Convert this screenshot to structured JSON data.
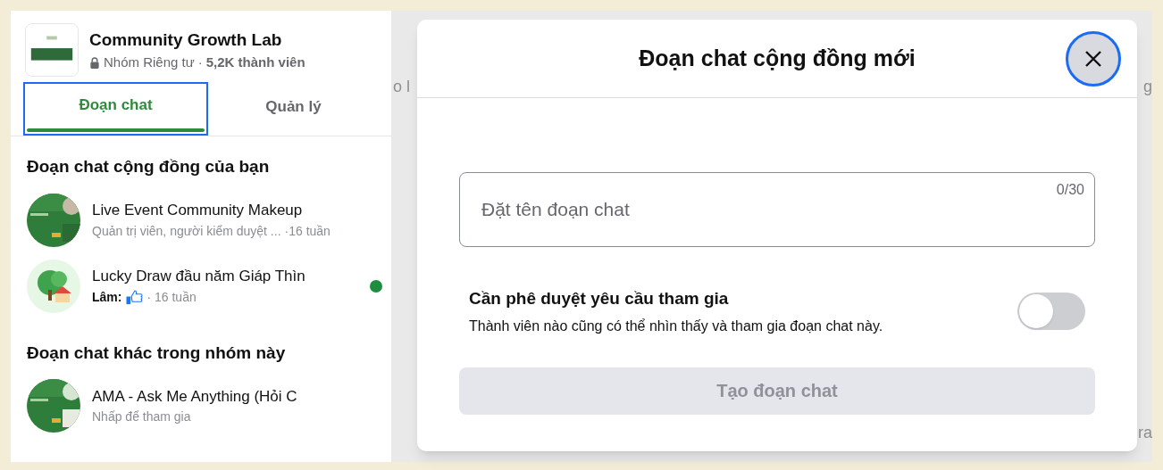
{
  "group": {
    "name": "Community Growth Lab",
    "privacy": "Nhóm Riêng tư",
    "separator": "·",
    "members": "5,2K thành viên"
  },
  "tabs": [
    {
      "label": "Đoạn chat",
      "selected": true
    },
    {
      "label": "Quản lý",
      "selected": false
    }
  ],
  "sections": [
    {
      "title": "Đoạn chat cộng đồng của bạn",
      "chats": [
        {
          "name": "Live Event Community Makeup",
          "preview": "Quản trị viên, người kiểm duyệt ...",
          "reaction": false,
          "time": "·16 tuần",
          "unread": false
        },
        {
          "name": "Lucky Draw đầu năm Giáp Thìn",
          "sender": "Lâm:",
          "reaction": true,
          "time": "· 16 tuần",
          "unread": true
        }
      ]
    },
    {
      "title": "Đoạn chat khác trong nhóm này",
      "chats": [
        {
          "name": "AMA - Ask Me Anything (Hỏi C",
          "preview": "Nhấp để tham gia",
          "reaction": false,
          "unread": false
        }
      ]
    }
  ],
  "background_fragments": [
    "o l",
    "g",
    "ra"
  ],
  "dialog": {
    "title": "Đoạn chat cộng đồng mới",
    "name_field": {
      "placeholder": "Đặt tên đoạn chat",
      "counter": "0/30"
    },
    "approval": {
      "title": "Cần phê duyệt yêu cầu tham gia",
      "description": "Thành viên nào cũng có thể nhìn thấy và tham gia đoạn chat này.",
      "on": false
    },
    "create_button": {
      "label": "Tạo đoạn chat",
      "disabled": true
    }
  }
}
